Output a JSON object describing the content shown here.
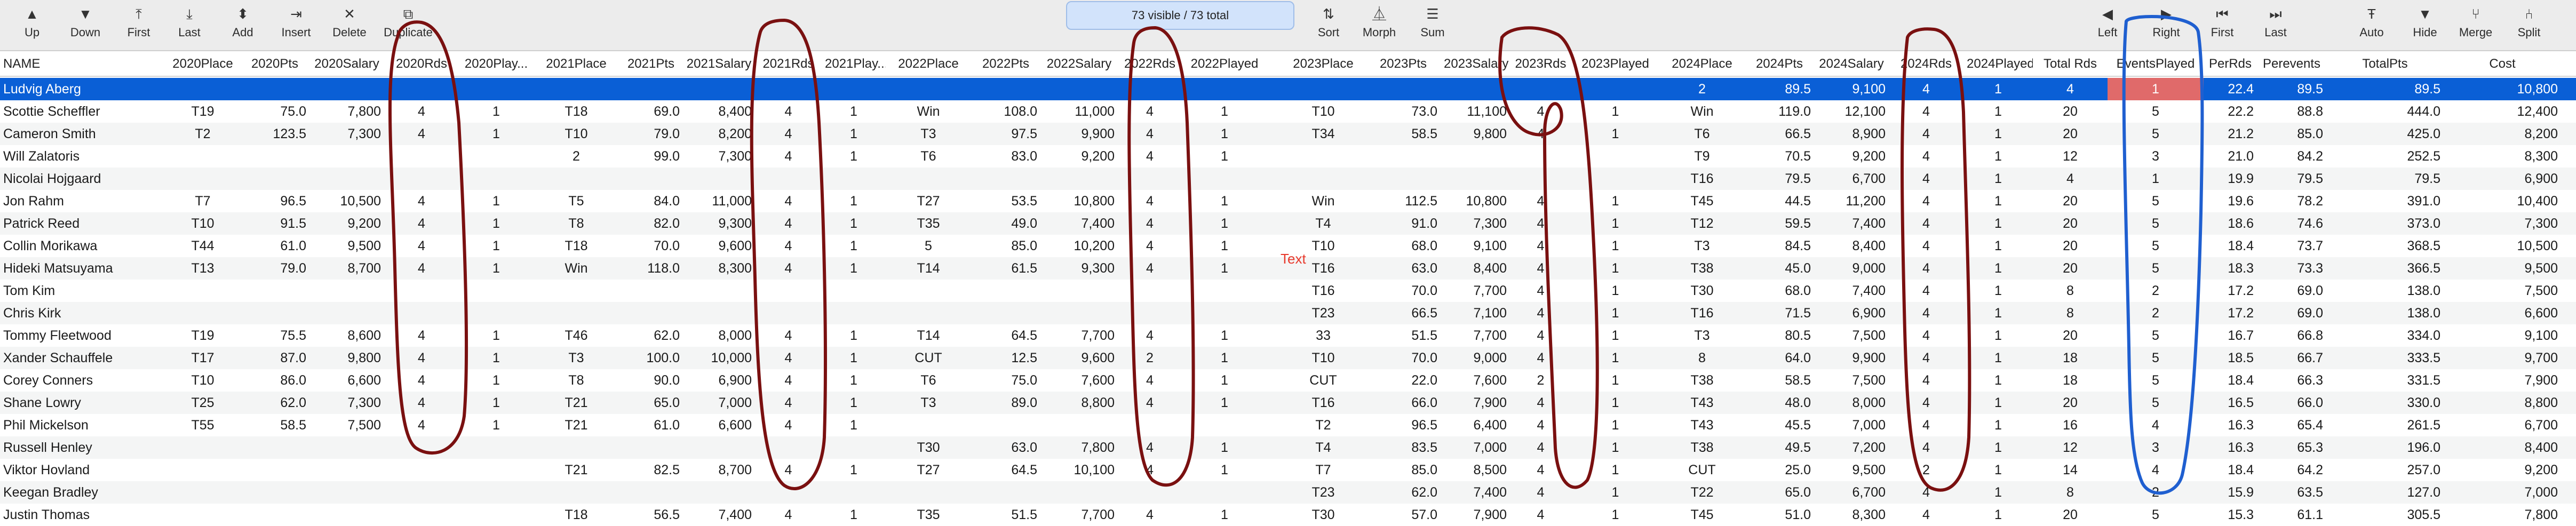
{
  "toolbar": {
    "buttons": [
      {
        "label": "Up",
        "icon": "triangle-up-icon",
        "glyph": "▲"
      },
      {
        "label": "Down",
        "icon": "triangle-down-icon",
        "glyph": "▼"
      },
      {
        "label": "First",
        "icon": "first-icon",
        "glyph": "⤒"
      },
      {
        "label": "Last",
        "icon": "last-icon",
        "glyph": "⤓"
      },
      {
        "label": "Add",
        "icon": "add-icon",
        "glyph": "⬍"
      },
      {
        "label": "Insert",
        "icon": "insert-icon",
        "glyph": "⇥"
      },
      {
        "label": "Delete",
        "icon": "delete-icon",
        "glyph": "✕"
      },
      {
        "label": "Duplicate",
        "icon": "duplicate-icon",
        "glyph": "⧉"
      },
      {
        "label": "Sort",
        "icon": "sort-icon",
        "glyph": "⇅"
      },
      {
        "label": "Morph",
        "icon": "morph-icon",
        "glyph": "⏅"
      },
      {
        "label": "Sum",
        "icon": "sum-icon",
        "glyph": "☰"
      },
      {
        "label": "Left",
        "icon": "left-icon",
        "glyph": "◀"
      },
      {
        "label": "Right",
        "icon": "right-icon",
        "glyph": "▶"
      },
      {
        "label": "First",
        "icon": "first-col-icon",
        "glyph": "⏮"
      },
      {
        "label": "Last",
        "icon": "last-col-icon",
        "glyph": "⏭"
      },
      {
        "label": "Auto",
        "icon": "auto-icon",
        "glyph": "Ŧ"
      },
      {
        "label": "Hide",
        "icon": "hide-icon",
        "glyph": "▼"
      },
      {
        "label": "Merge",
        "icon": "merge-icon",
        "glyph": "⑂"
      },
      {
        "label": "Split",
        "icon": "split-icon",
        "glyph": "⑃"
      }
    ],
    "status": "73 visible / 73 total"
  },
  "note_text": "Text",
  "columns": [
    "NAME",
    "2020Place",
    "2020Pts",
    "2020Salary",
    "2020Rds",
    "2020Played",
    "2021Place",
    "2021Pts",
    "2021Salary",
    "2021Rds",
    "2021Played",
    "2022Place",
    "2022Pts",
    "2022Salary",
    "2022Rds",
    "2022Played",
    "2023Place",
    "2023Pts",
    "2023Salary",
    "2023Rds",
    "2023Played",
    "2024Place",
    "2024Pts",
    "2024Salary",
    "2024Rds",
    "2024Played",
    "Total Rds",
    "EventsPlayed",
    "PerRds",
    "Perevents",
    "TotalPts",
    "Cost"
  ],
  "columns_display": [
    "NAME",
    "2020Place",
    "2020Pts",
    "2020Salary",
    "2020Rds",
    "2020Play...",
    "2021Place",
    "2021Pts",
    "2021Salary",
    "2021Rds",
    "2021Play...",
    "2022Place",
    "2022Pts",
    "2022Salary",
    "2022Rds",
    "2022Played",
    "2023Place",
    "2023Pts",
    "2023Salary",
    "2023Rds",
    "2023Played",
    "2024Place",
    "2024Pts",
    "2024Salary",
    "2024Rds",
    "2024Played",
    "Total Rds",
    "EventsPlayed",
    "PerRds",
    "Perevents",
    "TotalPts",
    "Cost"
  ],
  "rows": [
    [
      "Ludvig Aberg",
      "",
      "",
      "",
      "",
      "",
      "",
      "",
      "",
      "",
      "",
      "",
      "",
      "",
      "",
      "",
      "",
      "",
      "",
      "",
      "",
      "2",
      "89.5",
      "9,100",
      "4",
      "1",
      "4",
      "1",
      "22.4",
      "89.5",
      "89.5",
      "10,800"
    ],
    [
      "Scottie Scheffler",
      "T19",
      "75.0",
      "7,800",
      "4",
      "1",
      "T18",
      "69.0",
      "8,400",
      "4",
      "1",
      "Win",
      "108.0",
      "11,000",
      "4",
      "1",
      "T10",
      "73.0",
      "11,100",
      "4",
      "1",
      "Win",
      "119.0",
      "12,100",
      "4",
      "1",
      "20",
      "5",
      "22.2",
      "88.8",
      "444.0",
      "12,400"
    ],
    [
      "Cameron Smith",
      "T2",
      "123.5",
      "7,300",
      "4",
      "1",
      "T10",
      "79.0",
      "8,200",
      "4",
      "1",
      "T3",
      "97.5",
      "9,900",
      "4",
      "1",
      "T34",
      "58.5",
      "9,800",
      "4",
      "1",
      "T6",
      "66.5",
      "8,900",
      "4",
      "1",
      "20",
      "5",
      "21.2",
      "85.0",
      "425.0",
      "8,200"
    ],
    [
      "Will Zalatoris",
      "",
      "",
      "",
      "",
      "",
      "2",
      "99.0",
      "7,300",
      "4",
      "1",
      "T6",
      "83.0",
      "9,200",
      "4",
      "1",
      "",
      "",
      "",
      "",
      "",
      "T9",
      "70.5",
      "9,200",
      "4",
      "1",
      "12",
      "3",
      "21.0",
      "84.2",
      "252.5",
      "8,300"
    ],
    [
      "Nicolai Hojgaard",
      "",
      "",
      "",
      "",
      "",
      "",
      "",
      "",
      "",
      "",
      "",
      "",
      "",
      "",
      "",
      "",
      "",
      "",
      "",
      "",
      "T16",
      "79.5",
      "6,700",
      "4",
      "1",
      "4",
      "1",
      "19.9",
      "79.5",
      "79.5",
      "6,900"
    ],
    [
      "Jon Rahm",
      "T7",
      "96.5",
      "10,500",
      "4",
      "1",
      "T5",
      "84.0",
      "11,000",
      "4",
      "1",
      "T27",
      "53.5",
      "10,800",
      "4",
      "1",
      "Win",
      "112.5",
      "10,800",
      "4",
      "1",
      "T45",
      "44.5",
      "11,200",
      "4",
      "1",
      "20",
      "5",
      "19.6",
      "78.2",
      "391.0",
      "10,400"
    ],
    [
      "Patrick Reed",
      "T10",
      "91.5",
      "9,200",
      "4",
      "1",
      "T8",
      "82.0",
      "9,300",
      "4",
      "1",
      "T35",
      "49.0",
      "7,400",
      "4",
      "1",
      "T4",
      "91.0",
      "7,300",
      "4",
      "1",
      "T12",
      "59.5",
      "7,400",
      "4",
      "1",
      "20",
      "5",
      "18.6",
      "74.6",
      "373.0",
      "7,300"
    ],
    [
      "Collin Morikawa",
      "T44",
      "61.0",
      "9,500",
      "4",
      "1",
      "T18",
      "70.0",
      "9,600",
      "4",
      "1",
      "5",
      "85.0",
      "10,200",
      "4",
      "1",
      "T10",
      "68.0",
      "9,100",
      "4",
      "1",
      "T3",
      "84.5",
      "8,400",
      "4",
      "1",
      "20",
      "5",
      "18.4",
      "73.7",
      "368.5",
      "10,500"
    ],
    [
      "Hideki Matsuyama",
      "T13",
      "79.0",
      "8,700",
      "4",
      "1",
      "Win",
      "118.0",
      "8,300",
      "4",
      "1",
      "T14",
      "61.5",
      "9,300",
      "4",
      "1",
      "T16",
      "63.0",
      "8,400",
      "4",
      "1",
      "T38",
      "45.0",
      "9,000",
      "4",
      "1",
      "20",
      "5",
      "18.3",
      "73.3",
      "366.5",
      "9,500"
    ],
    [
      "Tom Kim",
      "",
      "",
      "",
      "",
      "",
      "",
      "",
      "",
      "",
      "",
      "",
      "",
      "",
      "",
      "",
      "T16",
      "70.0",
      "7,700",
      "4",
      "1",
      "T30",
      "68.0",
      "7,400",
      "4",
      "1",
      "8",
      "2",
      "17.2",
      "69.0",
      "138.0",
      "7,500"
    ],
    [
      "Chris Kirk",
      "",
      "",
      "",
      "",
      "",
      "",
      "",
      "",
      "",
      "",
      "",
      "",
      "",
      "",
      "",
      "T23",
      "66.5",
      "7,100",
      "4",
      "1",
      "T16",
      "71.5",
      "6,900",
      "4",
      "1",
      "8",
      "2",
      "17.2",
      "69.0",
      "138.0",
      "6,600"
    ],
    [
      "Tommy Fleetwood",
      "T19",
      "75.5",
      "8,600",
      "4",
      "1",
      "T46",
      "62.0",
      "8,000",
      "4",
      "1",
      "T14",
      "64.5",
      "7,700",
      "4",
      "1",
      "33",
      "51.5",
      "7,700",
      "4",
      "1",
      "T3",
      "80.5",
      "7,500",
      "4",
      "1",
      "20",
      "5",
      "16.7",
      "66.8",
      "334.0",
      "9,100"
    ],
    [
      "Xander Schauffele",
      "T17",
      "87.0",
      "9,800",
      "4",
      "1",
      "T3",
      "100.0",
      "10,000",
      "4",
      "1",
      "CUT",
      "12.5",
      "9,600",
      "2",
      "1",
      "T10",
      "70.0",
      "9,000",
      "4",
      "1",
      "8",
      "64.0",
      "9,900",
      "4",
      "1",
      "18",
      "5",
      "18.5",
      "66.7",
      "333.5",
      "9,700"
    ],
    [
      "Corey Conners",
      "T10",
      "86.0",
      "6,600",
      "4",
      "1",
      "T8",
      "90.0",
      "6,900",
      "4",
      "1",
      "T6",
      "75.0",
      "7,600",
      "4",
      "1",
      "CUT",
      "22.0",
      "7,600",
      "2",
      "1",
      "T38",
      "58.5",
      "7,500",
      "4",
      "1",
      "18",
      "5",
      "18.4",
      "66.3",
      "331.5",
      "7,900"
    ],
    [
      "Shane Lowry",
      "T25",
      "62.0",
      "7,300",
      "4",
      "1",
      "T21",
      "65.0",
      "7,000",
      "4",
      "1",
      "T3",
      "89.0",
      "8,800",
      "4",
      "1",
      "T16",
      "66.0",
      "7,900",
      "4",
      "1",
      "T43",
      "48.0",
      "8,000",
      "4",
      "1",
      "20",
      "5",
      "16.5",
      "66.0",
      "330.0",
      "8,800"
    ],
    [
      "Phil Mickelson",
      "T55",
      "58.5",
      "7,500",
      "4",
      "1",
      "T21",
      "61.0",
      "6,600",
      "4",
      "1",
      "",
      "",
      "",
      "",
      "",
      "T2",
      "96.5",
      "6,400",
      "4",
      "1",
      "T43",
      "45.5",
      "7,000",
      "4",
      "1",
      "16",
      "4",
      "16.3",
      "65.4",
      "261.5",
      "6,700"
    ],
    [
      "Russell Henley",
      "",
      "",
      "",
      "",
      "",
      "",
      "",
      "",
      "",
      "",
      "T30",
      "63.0",
      "7,800",
      "4",
      "1",
      "T4",
      "83.5",
      "7,000",
      "4",
      "1",
      "T38",
      "49.5",
      "7,200",
      "4",
      "1",
      "12",
      "3",
      "16.3",
      "65.3",
      "196.0",
      "8,400"
    ],
    [
      "Viktor Hovland",
      "",
      "",
      "",
      "",
      "",
      "T21",
      "82.5",
      "8,700",
      "4",
      "1",
      "T27",
      "64.5",
      "10,100",
      "4",
      "1",
      "T7",
      "85.0",
      "8,500",
      "4",
      "1",
      "CUT",
      "25.0",
      "9,500",
      "2",
      "1",
      "14",
      "4",
      "18.4",
      "64.2",
      "257.0",
      "9,200"
    ],
    [
      "Keegan Bradley",
      "",
      "",
      "",
      "",
      "",
      "",
      "",
      "",
      "",
      "",
      "",
      "",
      "",
      "",
      "",
      "T23",
      "62.0",
      "7,400",
      "4",
      "1",
      "T22",
      "65.0",
      "6,700",
      "4",
      "1",
      "8",
      "2",
      "15.9",
      "63.5",
      "127.0",
      "7,000"
    ],
    [
      "Justin Thomas",
      "",
      "",
      "",
      "",
      "",
      "T18",
      "56.5",
      "7,400",
      "4",
      "1",
      "T35",
      "51.5",
      "7,700",
      "4",
      "1",
      "T30",
      "57.0",
      "7,900",
      "4",
      "1",
      "T45",
      "51.0",
      "8,300",
      "4",
      "1",
      "20",
      "5",
      "15.3",
      "61.1",
      "305.5",
      "7,800"
    ]
  ]
}
